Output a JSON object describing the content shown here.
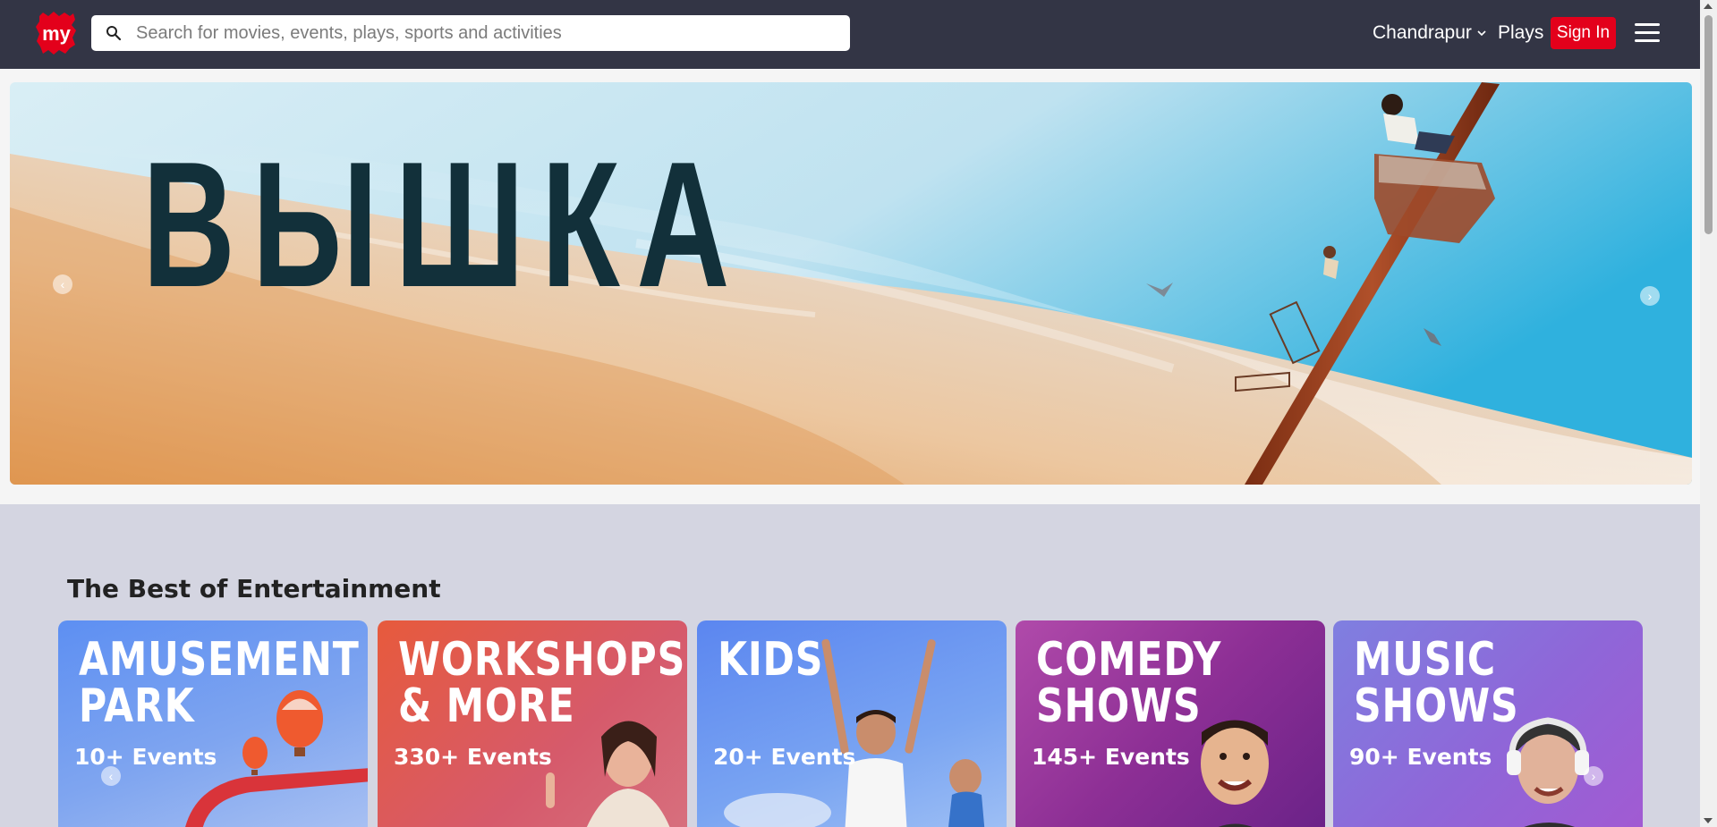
{
  "header": {
    "search_placeholder": "Search for movies, events, plays, sports and activities",
    "city": "Chandrapur",
    "plays": "Plays",
    "sign_in": "Sign In",
    "logo_text": "my"
  },
  "banner": {
    "title": "ВЫШКА"
  },
  "section": {
    "title": "The Best of Entertainment",
    "cards": [
      {
        "title": "AMUSEMENT\nPARK",
        "count": "10+ Events"
      },
      {
        "title": "WORKSHOPS\n& MORE",
        "count": "330+ Events"
      },
      {
        "title": "KIDS",
        "count": "20+ Events"
      },
      {
        "title": "COMEDY\nSHOWS",
        "count": "145+ Events"
      },
      {
        "title": "MUSIC\nSHOWS",
        "count": "90+ Events"
      }
    ]
  },
  "colors": {
    "header_bg": "#333545",
    "sign_in_bg": "#e3001b",
    "section_bg": "#d4d5e1"
  }
}
